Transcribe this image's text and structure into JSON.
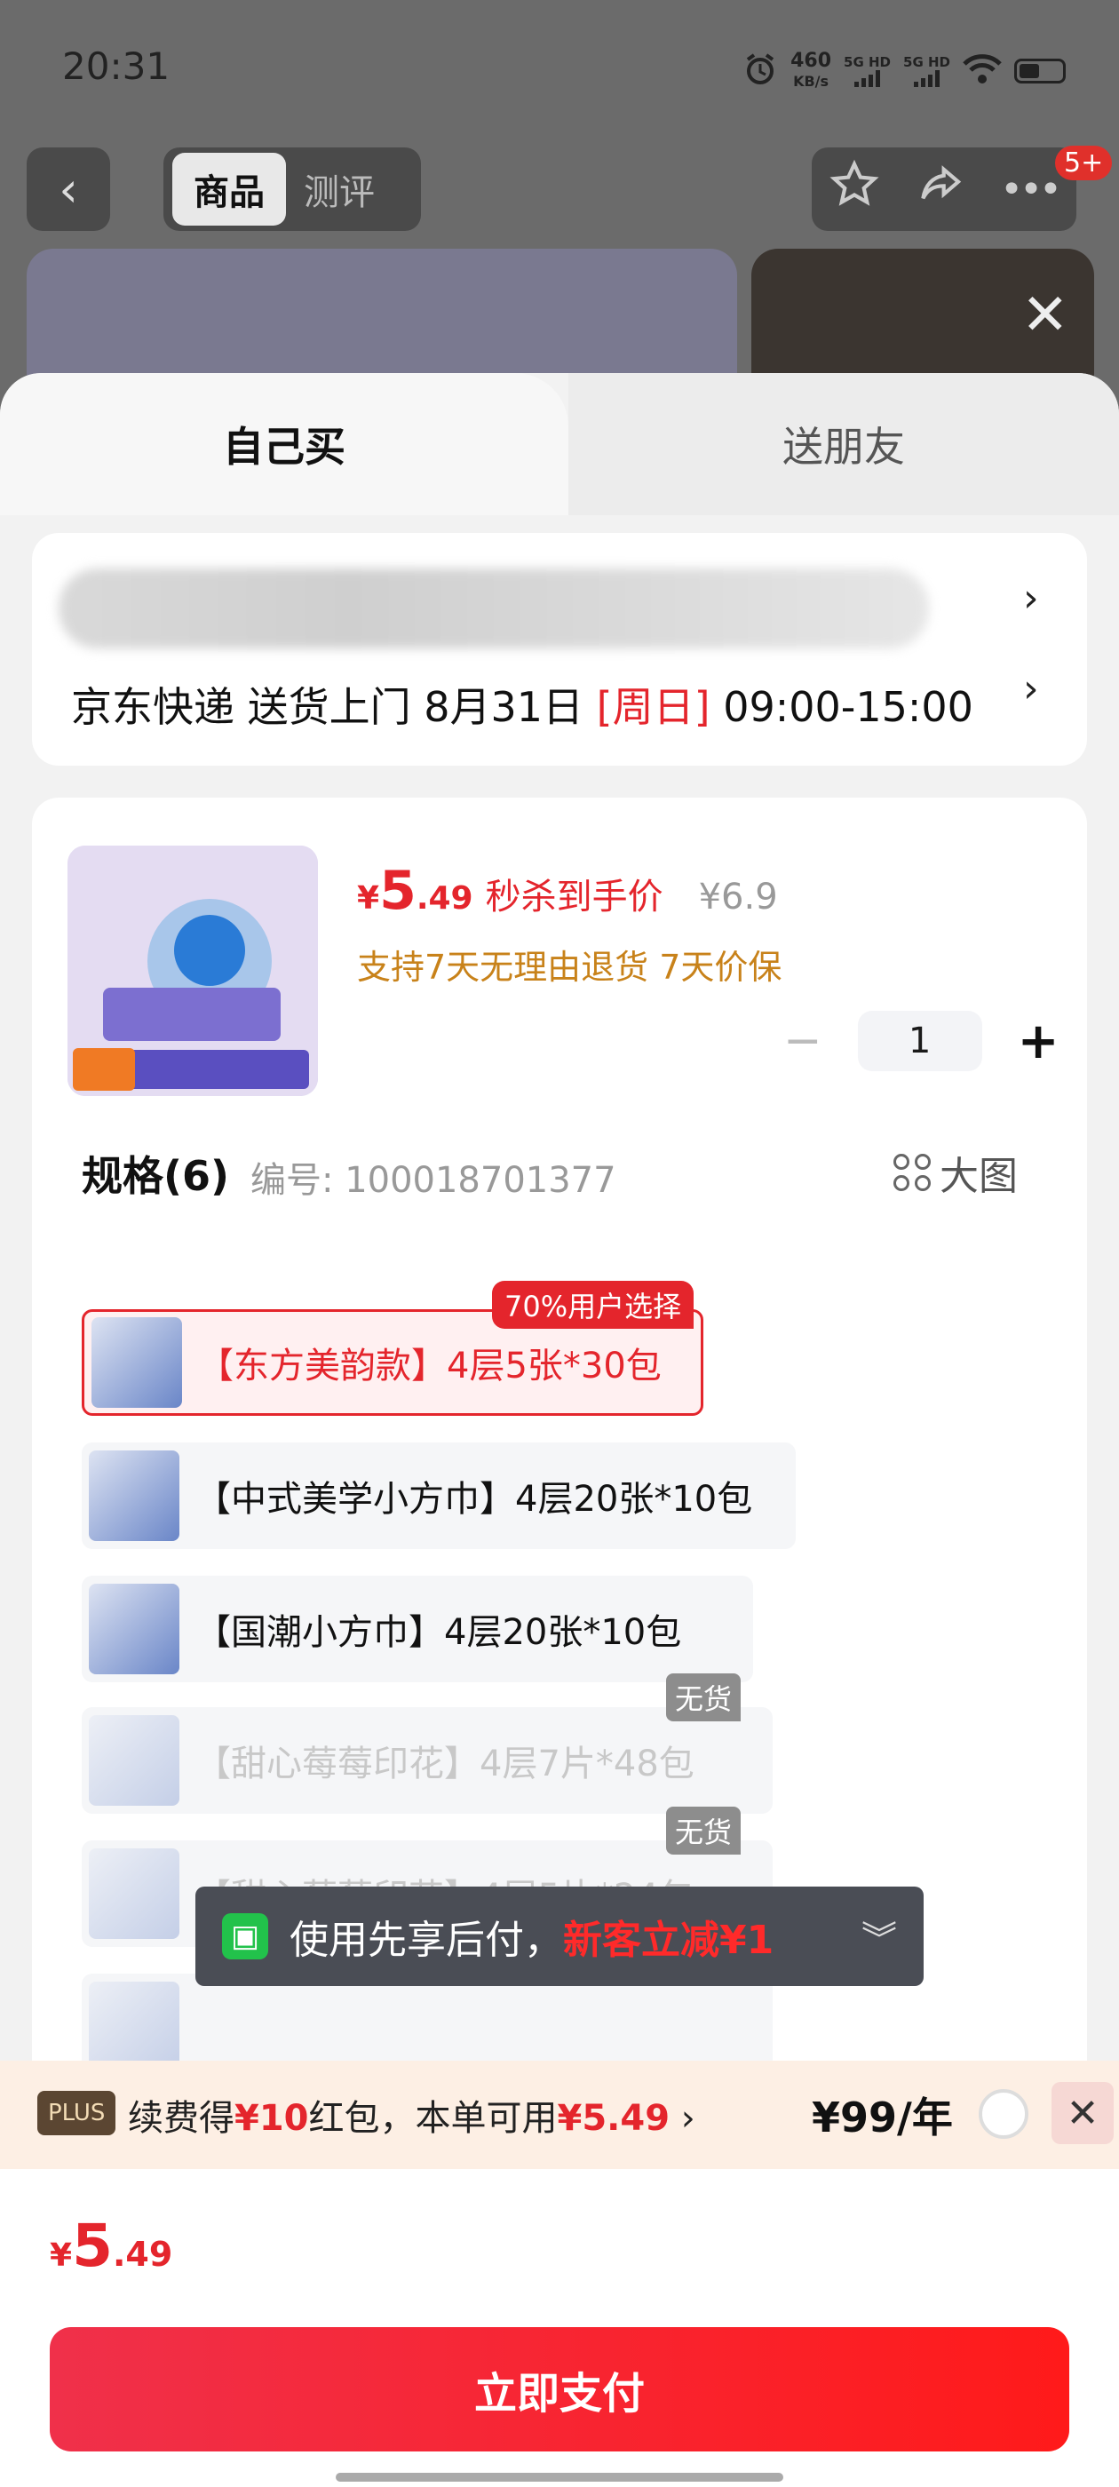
{
  "status_bar": {
    "time": "20:31",
    "net_speed_value": "460",
    "net_speed_unit": "KB/s",
    "sim1": "5G HD",
    "sim2": "5G HD"
  },
  "header": {
    "tabs": [
      "商品",
      "测评"
    ],
    "active_tab": "商品",
    "badge": "5+"
  },
  "sheet": {
    "tab_self": "自己买",
    "tab_gift": "送朋友",
    "delivery": {
      "carrier": "京东快递 送货上门 8月31日 ",
      "day": "[周日]",
      "window": " 09:00-15:00"
    },
    "product": {
      "currency": "¥",
      "price_int": "5",
      "price_dec": ".49",
      "price_label": "秒杀到手价",
      "original_price": "¥6.9",
      "guarantee": "支持7天无理由退货  7天价保",
      "quantity": "1"
    },
    "spec": {
      "title": "规格(6)",
      "number": "编号: 100018701377",
      "big_image": "大图",
      "popular_tag": "70%用户选择",
      "out_of_stock": "无货",
      "options": [
        "【东方美韵款】4层5张*30包",
        "【中式美学小方巾】4层20张*10包",
        "【国潮小方巾】4层20张*10包",
        "【甜心莓莓印花】4层7片*48包",
        "【甜心莓莓印花】4层5片*24包"
      ]
    }
  },
  "toast": {
    "text": "使用先享后付，",
    "highlight": "新客立减¥1"
  },
  "plus_bar": {
    "logo": "PLUS",
    "t1": "续费得",
    "t2": "¥10",
    "t3": "红包，本单可用",
    "t4": "¥5.49",
    "t5": " ›",
    "price": "¥99/年"
  },
  "bottom": {
    "currency": "¥",
    "price_int": "5",
    "price_dec": ".49",
    "pay_button": "立即支付"
  },
  "colors": {
    "accent_red": "#e4252c",
    "guarantee_orange": "#c8821a",
    "pay_green": "#22c24b"
  }
}
